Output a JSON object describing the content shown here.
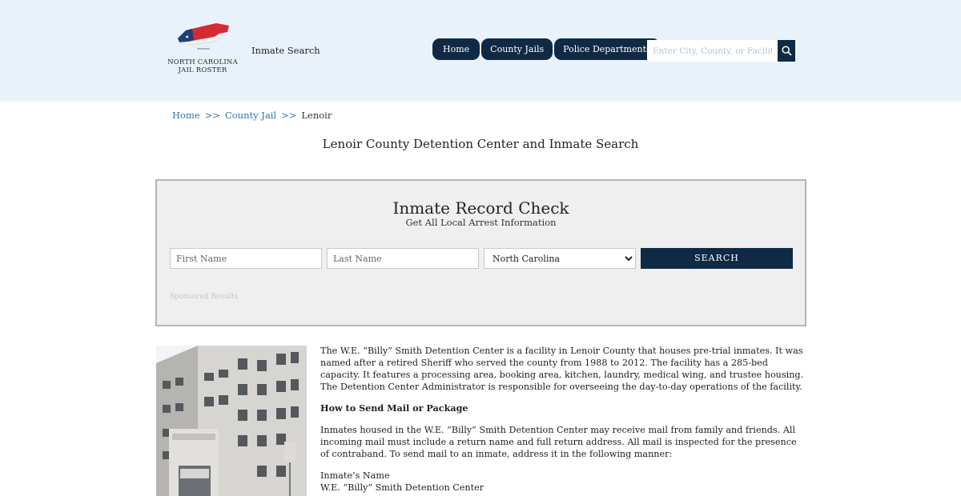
{
  "header": {
    "logo_lines": [
      "NORTH CAROLINA",
      "JAIL ROSTER"
    ],
    "site_link": "Inmate Search",
    "nav": [
      {
        "label": "Home"
      },
      {
        "label": "County Jails"
      },
      {
        "label": "Police Departments"
      }
    ],
    "search": {
      "placeholder": "Enter City, County, or Facility",
      "icon": "search-icon"
    }
  },
  "breadcrumb": {
    "items": [
      "Home",
      "County Jail",
      "Lenoir"
    ],
    "separator": ">>"
  },
  "page_title": "Lenoir County Detention Center and Inmate Search",
  "record_check": {
    "title": "Inmate Record Check",
    "subtitle": "Get All Local Arrest Information",
    "first_name_placeholder": "First Name",
    "last_name_placeholder": "Last Name",
    "state_selected": "North Carolina",
    "search_label": "SEARCH",
    "sponsored": "Sponsored Results"
  },
  "content": {
    "intro": "The W.E. “Billy” Smith Detention Center is a facility in Lenoir County that houses pre-trial inmates. It was named after a retired Sheriff who served the county from 1988 to 2012. The facility has a 285-bed capacity. It features a processing area, booking area, kitchen, laundry, medical wing, and trustee housing. The Detention Center Administrator is responsible for overseeing the day-to-day operations of the facility.",
    "mail_heading": "How to Send Mail or Package",
    "mail_text": "Inmates housed in the W.E. “Billy” Smith Detention Center may receive mail from family and friends. All incoming mail must include a return name and full return address. All mail is inspected for the presence of contraband. To send mail to an inmate, address it in the following manner:",
    "address_line1": "Inmate’s Name",
    "address_line2": "W.E. “Billy” Smith Detention Center"
  },
  "colors": {
    "header_bg": "#e9f2fb",
    "nav_bg": "#0f2a44",
    "link": "#2a72b5",
    "box_bg": "#efefef"
  }
}
